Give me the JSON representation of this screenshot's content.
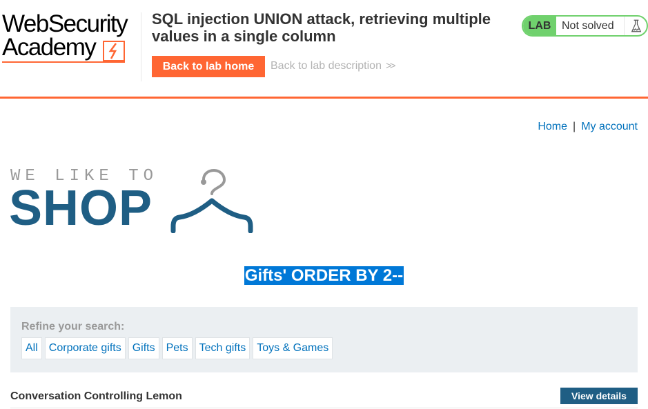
{
  "academy": {
    "logo_line1": "WebSecurity",
    "logo_line2": "Academy",
    "lab_title": "SQL injection UNION attack, retrieving multiple values in a single column",
    "back_home_label": "Back to lab home",
    "back_desc_label": "Back to lab description",
    "status_tag": "LAB",
    "status_text": "Not solved"
  },
  "nav": {
    "home": "Home",
    "separator": "|",
    "account": "My account"
  },
  "shop_logo": {
    "tagline": "WE LIKE TO",
    "word": "SHOP"
  },
  "search_heading": "Gifts' ORDER BY 2--",
  "filters": {
    "label": "Refine your search:",
    "categories": [
      "All",
      "Corporate gifts",
      "Gifts",
      "Pets",
      "Tech gifts",
      "Toys & Games"
    ]
  },
  "products": [
    {
      "name": "Conversation Controlling Lemon",
      "button": "View details"
    }
  ],
  "colors": {
    "accent_orange": "#ff6633",
    "status_green": "#70d16d",
    "shop_blue": "#1f5e84",
    "link_blue": "#0071bc",
    "selection_blue": "#0078d7"
  }
}
